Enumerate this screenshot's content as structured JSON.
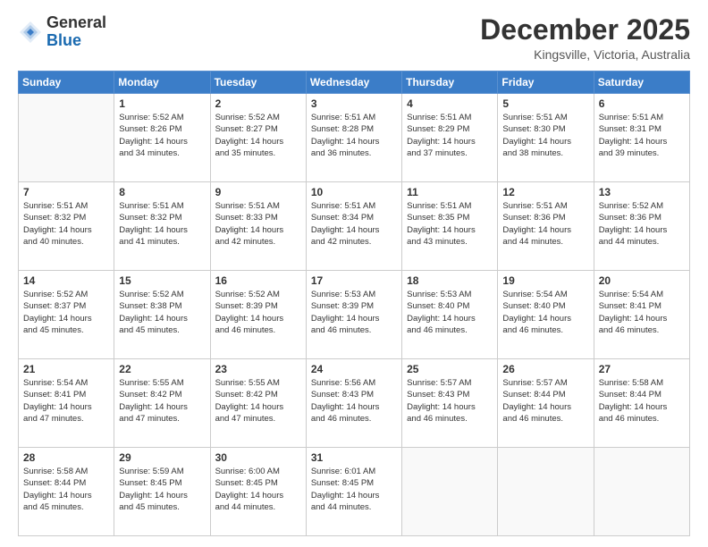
{
  "logo": {
    "general": "General",
    "blue": "Blue"
  },
  "header": {
    "month": "December 2025",
    "location": "Kingsville, Victoria, Australia"
  },
  "weekdays": [
    "Sunday",
    "Monday",
    "Tuesday",
    "Wednesday",
    "Thursday",
    "Friday",
    "Saturday"
  ],
  "weeks": [
    [
      {
        "day": "",
        "content": ""
      },
      {
        "day": "1",
        "content": "Sunrise: 5:52 AM\nSunset: 8:26 PM\nDaylight: 14 hours\nand 34 minutes."
      },
      {
        "day": "2",
        "content": "Sunrise: 5:52 AM\nSunset: 8:27 PM\nDaylight: 14 hours\nand 35 minutes."
      },
      {
        "day": "3",
        "content": "Sunrise: 5:51 AM\nSunset: 8:28 PM\nDaylight: 14 hours\nand 36 minutes."
      },
      {
        "day": "4",
        "content": "Sunrise: 5:51 AM\nSunset: 8:29 PM\nDaylight: 14 hours\nand 37 minutes."
      },
      {
        "day": "5",
        "content": "Sunrise: 5:51 AM\nSunset: 8:30 PM\nDaylight: 14 hours\nand 38 minutes."
      },
      {
        "day": "6",
        "content": "Sunrise: 5:51 AM\nSunset: 8:31 PM\nDaylight: 14 hours\nand 39 minutes."
      }
    ],
    [
      {
        "day": "7",
        "content": "Sunrise: 5:51 AM\nSunset: 8:32 PM\nDaylight: 14 hours\nand 40 minutes."
      },
      {
        "day": "8",
        "content": "Sunrise: 5:51 AM\nSunset: 8:32 PM\nDaylight: 14 hours\nand 41 minutes."
      },
      {
        "day": "9",
        "content": "Sunrise: 5:51 AM\nSunset: 8:33 PM\nDaylight: 14 hours\nand 42 minutes."
      },
      {
        "day": "10",
        "content": "Sunrise: 5:51 AM\nSunset: 8:34 PM\nDaylight: 14 hours\nand 42 minutes."
      },
      {
        "day": "11",
        "content": "Sunrise: 5:51 AM\nSunset: 8:35 PM\nDaylight: 14 hours\nand 43 minutes."
      },
      {
        "day": "12",
        "content": "Sunrise: 5:51 AM\nSunset: 8:36 PM\nDaylight: 14 hours\nand 44 minutes."
      },
      {
        "day": "13",
        "content": "Sunrise: 5:52 AM\nSunset: 8:36 PM\nDaylight: 14 hours\nand 44 minutes."
      }
    ],
    [
      {
        "day": "14",
        "content": "Sunrise: 5:52 AM\nSunset: 8:37 PM\nDaylight: 14 hours\nand 45 minutes."
      },
      {
        "day": "15",
        "content": "Sunrise: 5:52 AM\nSunset: 8:38 PM\nDaylight: 14 hours\nand 45 minutes."
      },
      {
        "day": "16",
        "content": "Sunrise: 5:52 AM\nSunset: 8:39 PM\nDaylight: 14 hours\nand 46 minutes."
      },
      {
        "day": "17",
        "content": "Sunrise: 5:53 AM\nSunset: 8:39 PM\nDaylight: 14 hours\nand 46 minutes."
      },
      {
        "day": "18",
        "content": "Sunrise: 5:53 AM\nSunset: 8:40 PM\nDaylight: 14 hours\nand 46 minutes."
      },
      {
        "day": "19",
        "content": "Sunrise: 5:54 AM\nSunset: 8:40 PM\nDaylight: 14 hours\nand 46 minutes."
      },
      {
        "day": "20",
        "content": "Sunrise: 5:54 AM\nSunset: 8:41 PM\nDaylight: 14 hours\nand 46 minutes."
      }
    ],
    [
      {
        "day": "21",
        "content": "Sunrise: 5:54 AM\nSunset: 8:41 PM\nDaylight: 14 hours\nand 47 minutes."
      },
      {
        "day": "22",
        "content": "Sunrise: 5:55 AM\nSunset: 8:42 PM\nDaylight: 14 hours\nand 47 minutes."
      },
      {
        "day": "23",
        "content": "Sunrise: 5:55 AM\nSunset: 8:42 PM\nDaylight: 14 hours\nand 47 minutes."
      },
      {
        "day": "24",
        "content": "Sunrise: 5:56 AM\nSunset: 8:43 PM\nDaylight: 14 hours\nand 46 minutes."
      },
      {
        "day": "25",
        "content": "Sunrise: 5:57 AM\nSunset: 8:43 PM\nDaylight: 14 hours\nand 46 minutes."
      },
      {
        "day": "26",
        "content": "Sunrise: 5:57 AM\nSunset: 8:44 PM\nDaylight: 14 hours\nand 46 minutes."
      },
      {
        "day": "27",
        "content": "Sunrise: 5:58 AM\nSunset: 8:44 PM\nDaylight: 14 hours\nand 46 minutes."
      }
    ],
    [
      {
        "day": "28",
        "content": "Sunrise: 5:58 AM\nSunset: 8:44 PM\nDaylight: 14 hours\nand 45 minutes."
      },
      {
        "day": "29",
        "content": "Sunrise: 5:59 AM\nSunset: 8:45 PM\nDaylight: 14 hours\nand 45 minutes."
      },
      {
        "day": "30",
        "content": "Sunrise: 6:00 AM\nSunset: 8:45 PM\nDaylight: 14 hours\nand 44 minutes."
      },
      {
        "day": "31",
        "content": "Sunrise: 6:01 AM\nSunset: 8:45 PM\nDaylight: 14 hours\nand 44 minutes."
      },
      {
        "day": "",
        "content": ""
      },
      {
        "day": "",
        "content": ""
      },
      {
        "day": "",
        "content": ""
      }
    ]
  ]
}
